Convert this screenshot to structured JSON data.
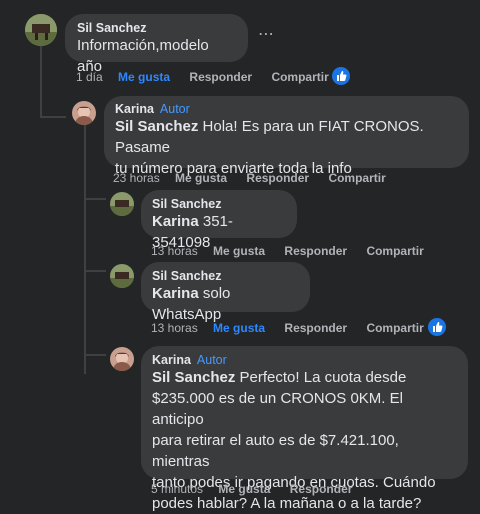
{
  "comments": [
    {
      "author": "Sil Sanchez",
      "badge": "",
      "mention": "",
      "text": "Información,modelo año",
      "time": "1 día",
      "like": "Me gusta",
      "reply": "Responder",
      "share": "Compartir",
      "liked": true,
      "reaction": "like"
    },
    {
      "author": "Karina",
      "badge": "Autor",
      "mention": "Sil Sanchez",
      "text_line1": " Hola! Es para un FIAT CRONOS. Pasame",
      "text_line2": "tu número para enviarte toda la info",
      "time": "23 horas",
      "like": "Me gusta",
      "reply": "Responder",
      "share": "Compartir"
    },
    {
      "author": "Sil Sanchez",
      "mention": "Karina",
      "text": " 351-3541098",
      "time": "13 horas",
      "like": "Me gusta",
      "reply": "Responder",
      "share": "Compartir"
    },
    {
      "author": "Sil Sanchez",
      "mention": "Karina",
      "text": " solo WhatsApp",
      "time": "13 horas",
      "like": "Me gusta",
      "reply": "Responder",
      "share": "Compartir",
      "liked": true,
      "reaction": "like"
    },
    {
      "author": "Karina",
      "badge": "Autor",
      "mention": "Sil Sanchez",
      "text_line1": " Perfecto! La cuota desde",
      "text_line2": "$235.000 es de un CRONOS 0KM. El anticipo",
      "text_line3": "para retirar el auto es de $7.421.100, mientras",
      "text_line4": "tanto podes ir pagando en cuotas. Cuándo",
      "text_line5": "podes hablar? A la mañana o a la tarde?",
      "time": "5 minutos",
      "like": "Me gusta",
      "reply": "Responder"
    }
  ],
  "more_icon": "more-horizontal-icon",
  "colors": {
    "background": "#242526",
    "bubble": "#3a3b3c",
    "link": "#2d88ff",
    "author_badge": "#4599ff"
  }
}
